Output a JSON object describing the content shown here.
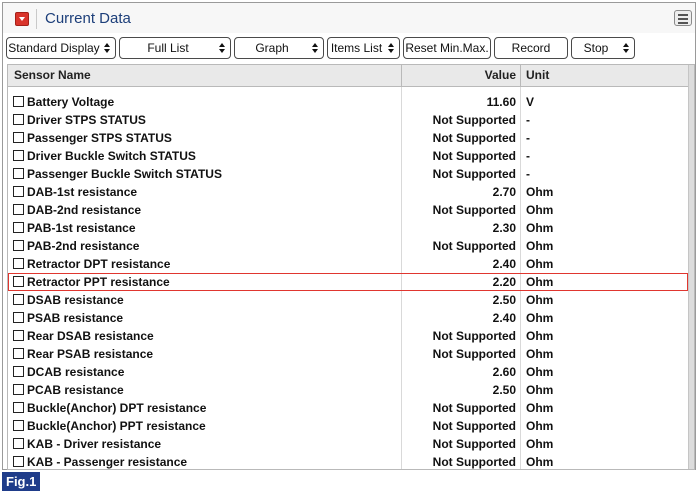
{
  "window": {
    "title": "Current Data"
  },
  "toolbar": {
    "buttons": [
      {
        "label": "Standard Display",
        "spinner": true
      },
      {
        "label": "Full List",
        "spinner": true
      },
      {
        "label": "Graph",
        "spinner": true
      },
      {
        "label": "Items List",
        "spinner": true
      },
      {
        "label": "Reset Min.Max.",
        "spinner": false
      },
      {
        "label": "Record",
        "spinner": false
      },
      {
        "label": "Stop",
        "spinner": true
      }
    ]
  },
  "table": {
    "headers": {
      "name": "Sensor Name",
      "value": "Value",
      "unit": "Unit"
    },
    "highlighted_row": 10,
    "rows": [
      {
        "name": "Battery Voltage",
        "value": "11.60",
        "unit": "V"
      },
      {
        "name": "Driver STPS STATUS",
        "value": "Not Supported",
        "unit": "-"
      },
      {
        "name": "Passenger STPS STATUS",
        "value": "Not Supported",
        "unit": "-"
      },
      {
        "name": "Driver Buckle Switch STATUS",
        "value": "Not Supported",
        "unit": "-"
      },
      {
        "name": "Passenger Buckle Switch STATUS",
        "value": "Not Supported",
        "unit": "-"
      },
      {
        "name": "DAB-1st resistance",
        "value": "2.70",
        "unit": "Ohm"
      },
      {
        "name": "DAB-2nd resistance",
        "value": "Not Supported",
        "unit": "Ohm"
      },
      {
        "name": "PAB-1st resistance",
        "value": "2.30",
        "unit": "Ohm"
      },
      {
        "name": "PAB-2nd resistance",
        "value": "Not Supported",
        "unit": "Ohm"
      },
      {
        "name": "Retractor DPT resistance",
        "value": "2.40",
        "unit": "Ohm"
      },
      {
        "name": "Retractor PPT resistance",
        "value": "2.20",
        "unit": "Ohm"
      },
      {
        "name": "DSAB resistance",
        "value": "2.50",
        "unit": "Ohm"
      },
      {
        "name": "PSAB resistance",
        "value": "2.40",
        "unit": "Ohm"
      },
      {
        "name": "Rear DSAB resistance",
        "value": "Not Supported",
        "unit": "Ohm"
      },
      {
        "name": "Rear PSAB resistance",
        "value": "Not Supported",
        "unit": "Ohm"
      },
      {
        "name": "DCAB resistance",
        "value": "2.60",
        "unit": "Ohm"
      },
      {
        "name": "PCAB resistance",
        "value": "2.50",
        "unit": "Ohm"
      },
      {
        "name": "Buckle(Anchor) DPT resistance",
        "value": "Not Supported",
        "unit": "Ohm"
      },
      {
        "name": "Buckle(Anchor) PPT resistance",
        "value": "Not Supported",
        "unit": "Ohm"
      },
      {
        "name": "KAB - Driver resistance",
        "value": "Not Supported",
        "unit": "Ohm"
      },
      {
        "name": "KAB - Passenger resistance",
        "value": "Not Supported",
        "unit": "Ohm"
      }
    ]
  },
  "figure": {
    "label": "Fig.1"
  },
  "colors": {
    "title": "#1d3f7a",
    "highlight": "#e0362f",
    "fig_label_bg": "#1f3c8a",
    "collapse_button": "#d9342b"
  }
}
